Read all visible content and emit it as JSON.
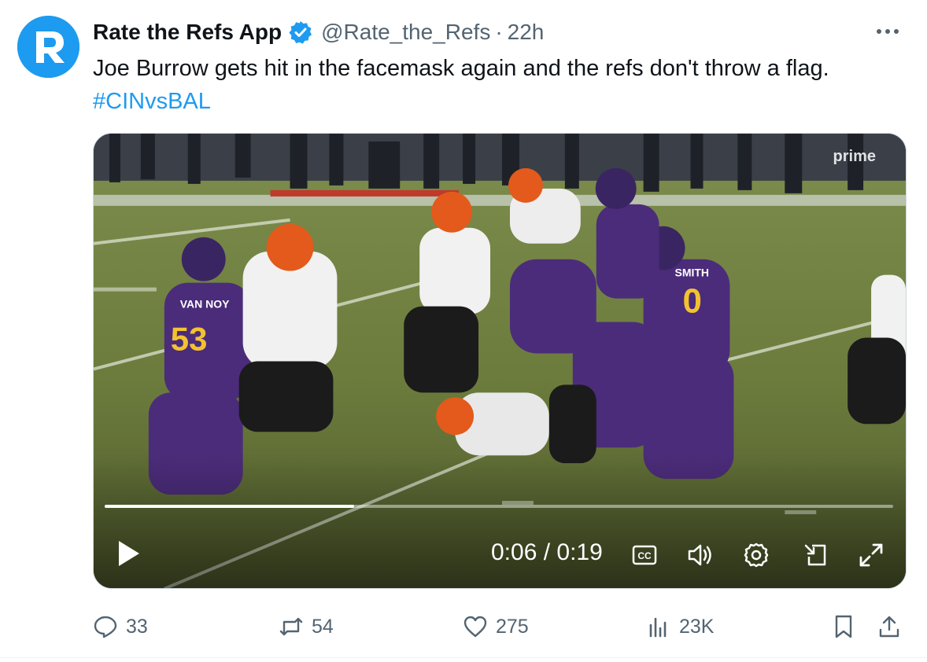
{
  "author": {
    "display_name": "Rate the Refs App",
    "handle": "@Rate_the_Refs",
    "separator": "·",
    "time": "22h",
    "avatar_letter": "R",
    "verified_icon": "verified-badge-icon"
  },
  "tweet": {
    "text": "Joe Burrow gets hit in the facemask again and the refs don't throw a flag.",
    "hashtag": "#CINvsBAL"
  },
  "video": {
    "current_time": "0:06",
    "duration": "0:19",
    "timecode": "0:06 / 0:19",
    "progress": 0.316,
    "watermark": "prime"
  },
  "actions": {
    "replies": "33",
    "retweets": "54",
    "likes": "275",
    "views": "23K"
  },
  "colors": {
    "accent": "#1d9bf0",
    "muted": "#536471",
    "text": "#0f1419"
  }
}
